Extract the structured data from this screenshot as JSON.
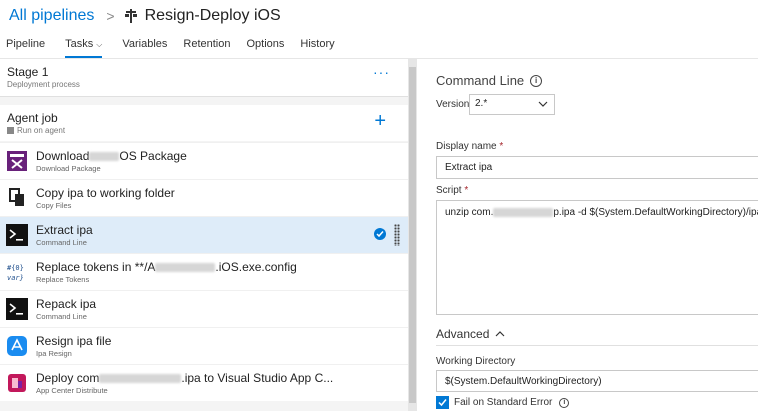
{
  "header": {
    "breadcrumb_root": "All pipelines",
    "separator": ">",
    "pipeline_title": "Resign-Deploy iOS"
  },
  "tabs": [
    {
      "label": "Pipeline"
    },
    {
      "label": "Tasks"
    },
    {
      "label": "Variables"
    },
    {
      "label": "Retention"
    },
    {
      "label": "Options"
    },
    {
      "label": "History"
    }
  ],
  "stage": {
    "title": "Stage 1",
    "subtitle": "Deployment process",
    "more": "···"
  },
  "agent_job": {
    "title": "Agent job",
    "subtitle": "Run on agent",
    "add": "+"
  },
  "tasks": [
    {
      "title_a": "Download",
      "title_b": "OS Package",
      "subtitle": "Download Package",
      "icon": "download-package-icon"
    },
    {
      "title_a": "Copy ipa to working folder",
      "title_b": "",
      "subtitle": "Copy Files",
      "icon": "copy-files-icon"
    },
    {
      "title_a": "Extract ipa",
      "title_b": "",
      "subtitle": "Command Line",
      "icon": "command-line-icon",
      "selected": true
    },
    {
      "title_a": "Replace tokens in **/A",
      "title_b": ".iOS.exe.config",
      "subtitle": "Replace Tokens",
      "icon": "replace-tokens-icon"
    },
    {
      "title_a": "Repack ipa",
      "title_b": "",
      "subtitle": "Command Line",
      "icon": "command-line-icon"
    },
    {
      "title_a": "Resign ipa file",
      "title_b": "",
      "subtitle": "Ipa Resign",
      "icon": "ipa-resign-icon"
    },
    {
      "title_a": "Deploy com",
      "title_b": ".ipa to Visual Studio App C...",
      "subtitle": "App Center Distribute",
      "icon": "app-center-icon"
    }
  ],
  "detail": {
    "title": "Command Line",
    "version_label": "Version",
    "version_value": "2.*",
    "display_name_label": "Display name",
    "required_mark": "*",
    "display_name_value": "Extract ipa",
    "script_label": "Script",
    "script_prefix": "unzip com.",
    "script_suffix": "p.ipa -d $(System.DefaultWorkingDirectory)/ipa",
    "advanced_label": "Advanced",
    "working_dir_label": "Working Directory",
    "working_dir_value": "$(System.DefaultWorkingDirectory)",
    "fail_on_stderr_label": "Fail on Standard Error",
    "fail_on_stderr_checked": true
  },
  "colors": {
    "accent": "#0078d4",
    "selected_row": "#deecf9",
    "panel_bg": "#f4f4f4"
  }
}
